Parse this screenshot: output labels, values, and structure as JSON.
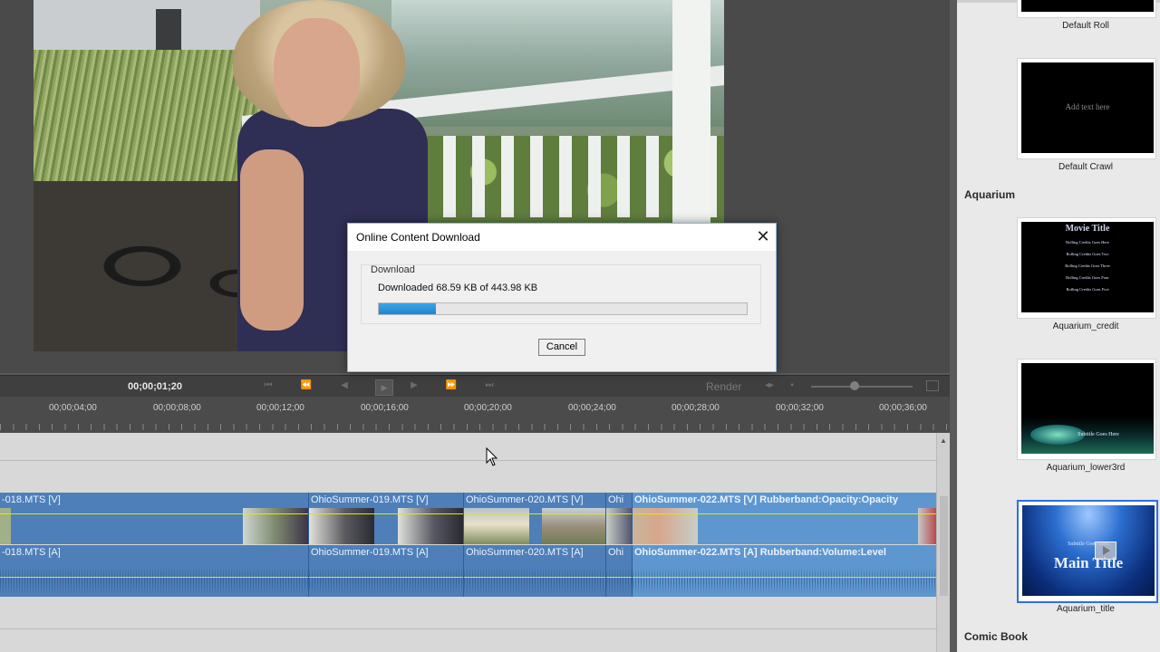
{
  "dialog": {
    "title": "Online Content Download",
    "group_label": "Download",
    "status": "Downloaded 68.59 KB of 443.98 KB",
    "progress_fraction": 0.155,
    "cancel_label": "Cancel"
  },
  "timeline": {
    "current_timecode": "00;00;01;20",
    "render_label": "Render",
    "ruler": [
      "00;00;04;00",
      "00;00;08;00",
      "00;00;12;00",
      "00;00;16;00",
      "00;00;20;00",
      "00;00;24;00",
      "00;00;28;00",
      "00;00;32;00",
      "00;00;36;00"
    ],
    "video_clips": [
      {
        "label": "-018.MTS [V]"
      },
      {
        "label": "OhioSummer-019.MTS [V]"
      },
      {
        "label": "OhioSummer-020.MTS [V]"
      },
      {
        "label": "Ohi"
      },
      {
        "label": "OhioSummer-022.MTS [V] Rubberband:Opacity:Opacity"
      }
    ],
    "audio_clips": [
      {
        "label": "-018.MTS [A]"
      },
      {
        "label": "OhioSummer-019.MTS [A]"
      },
      {
        "label": "OhioSummer-020.MTS [A]"
      },
      {
        "label": "Ohi"
      },
      {
        "label": "OhioSummer-022.MTS [A] Rubberband:Volume:Level"
      }
    ]
  },
  "panel": {
    "templates_top": [
      {
        "name": "Default Roll"
      },
      {
        "name": "Default Crawl",
        "thumb_text": "Add text here"
      }
    ],
    "section_aquarium": "Aquarium",
    "aquarium": [
      {
        "name": "Aquarium_credit",
        "thumb_title": "Movie Title",
        "thumb_lines": [
          "Rolling Credits Goes Here",
          "Rolling Credits Goes Two",
          "Rolling Credits Goes Three",
          "Rolling Credits Goes Four",
          "Rolling Credits Goes Five"
        ]
      },
      {
        "name": "Aquarium_lower3rd",
        "thumb_text": "Subtitle Goes Here"
      },
      {
        "name": "Aquarium_title",
        "thumb_sub": "Subtitle Goes Here",
        "thumb_title": "Main Title"
      }
    ],
    "section_comic": "Comic Book"
  }
}
